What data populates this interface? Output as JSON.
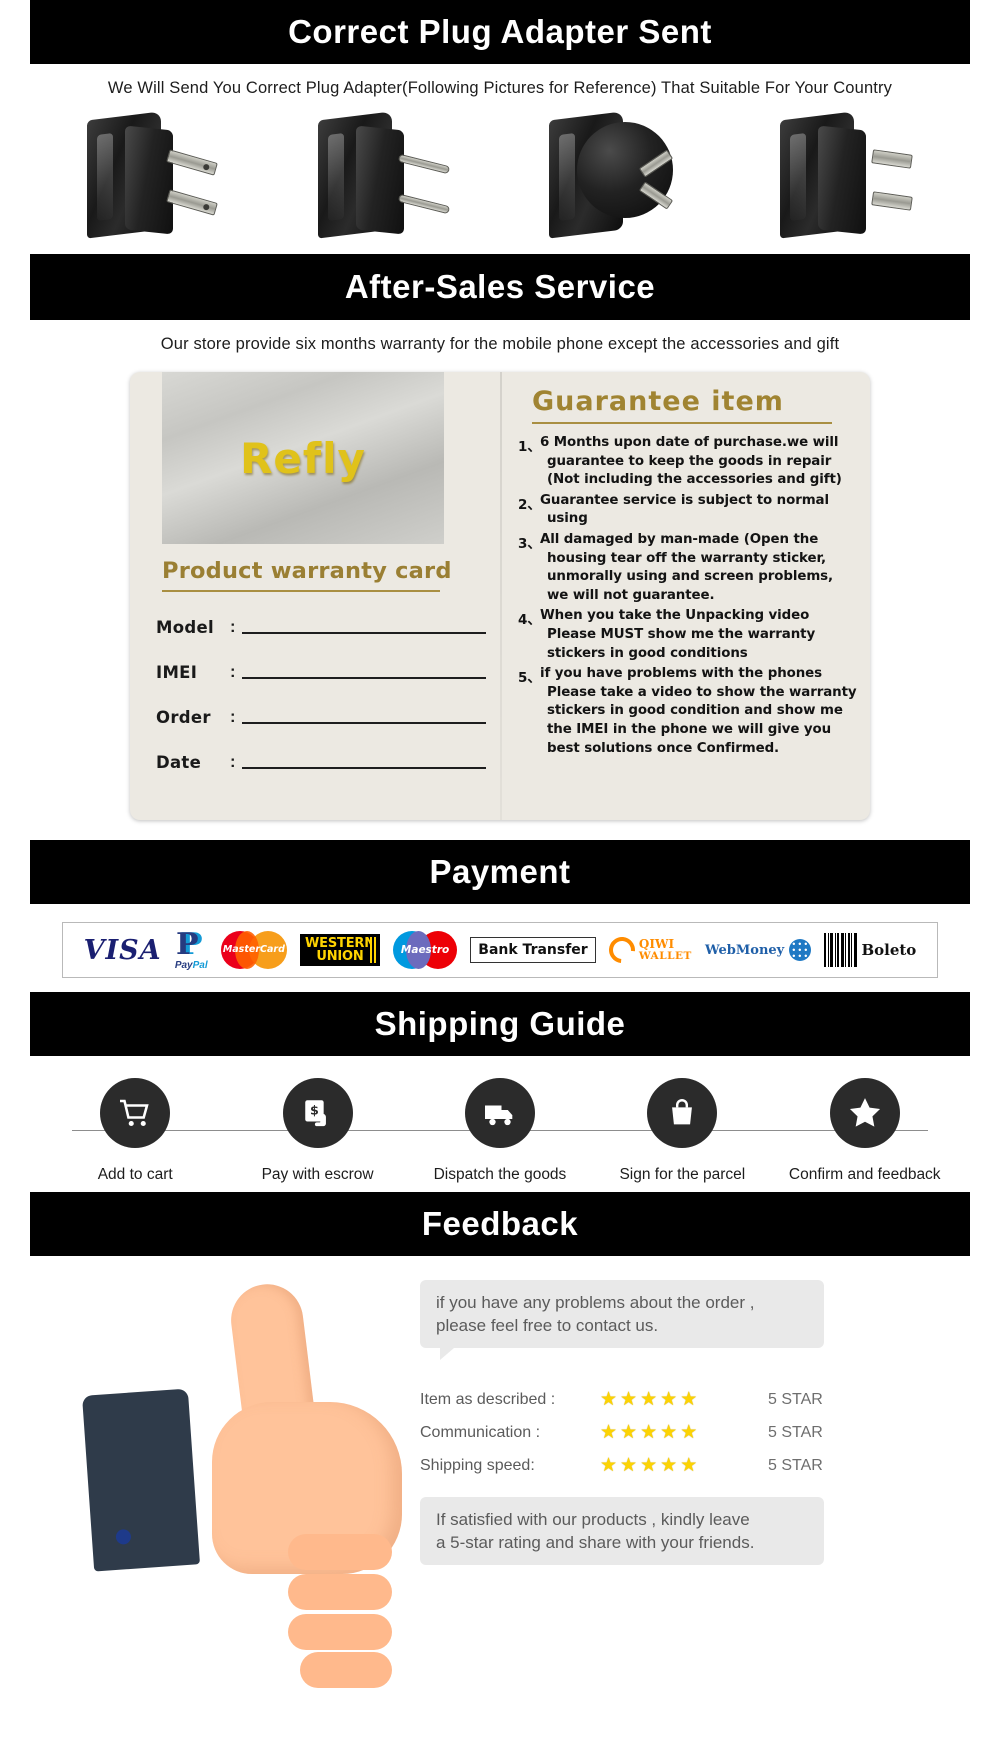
{
  "sections": {
    "plug": {
      "banner": "Correct Plug Adapter Sent",
      "subtitle": "We Will Send You Correct Plug Adapter(Following Pictures for Reference) That Suitable For Your Country",
      "adapters": [
        {
          "name": "us-plug-adapter",
          "type": "US"
        },
        {
          "name": "eu-plug-adapter",
          "type": "EU"
        },
        {
          "name": "au-plug-adapter",
          "type": "AU"
        },
        {
          "name": "uk-plug-adapter",
          "type": "UK"
        }
      ]
    },
    "after_sales": {
      "banner": "After-Sales Service",
      "note": "Our store provide  six months warranty  for the mobile  phone  except the  accessories and gift",
      "card": {
        "brand": "Refly",
        "title": "Product warranty card",
        "fields": [
          {
            "label": "Model",
            "colon": ":",
            "value": ""
          },
          {
            "label": "IMEI",
            "colon": ":",
            "value": ""
          },
          {
            "label": "Order",
            "colon": ":",
            "value": ""
          },
          {
            "label": "Date",
            "colon": ":",
            "value": ""
          }
        ],
        "guarantee_title": "Guarantee  item",
        "guarantee_items": [
          {
            "num": "1、",
            "lines": [
              "6 Months upon date of purchase.we will",
              "guarantee to keep the goods in repair",
              "(Not including the accessories and gift)"
            ]
          },
          {
            "num": "2、",
            "lines": [
              "Guarantee service is subject to normal",
              "using"
            ]
          },
          {
            "num": "3、",
            "lines": [
              "All damaged by man-made (Open the",
              "housing tear off the warranty sticker,",
              "unmorally using and screen problems,",
              "we will not guarantee."
            ]
          },
          {
            "num": "4、",
            "lines": [
              "When you take the Unpacking video",
              "Please MUST show me the warranty",
              "stickers in good conditions"
            ]
          },
          {
            "num": "5、",
            "lines": [
              "if you have problems with the phones",
              "Please take a video to show the warranty",
              "stickers in good condition and show me",
              "the IMEI in the phone we will give you",
              "best solutions once  Confirmed."
            ]
          }
        ]
      }
    },
    "payment": {
      "banner": "Payment",
      "methods": [
        {
          "name": "visa-logo",
          "label": "VISA"
        },
        {
          "name": "paypal-logo",
          "label": "PayPal"
        },
        {
          "name": "mastercard-logo",
          "label": "MasterCard"
        },
        {
          "name": "western-union-logo",
          "label": "WESTERN UNION",
          "line1": "WESTERN",
          "line2": "UNION"
        },
        {
          "name": "maestro-logo",
          "label": "Maestro"
        },
        {
          "name": "bank-transfer-logo",
          "label": "Bank Transfer"
        },
        {
          "name": "qiwi-wallet-logo",
          "label": "QIWI WALLET",
          "line1": "QIWI",
          "line2": "WALLET"
        },
        {
          "name": "webmoney-logo",
          "label": "WebMoney"
        },
        {
          "name": "boleto-logo",
          "label": "Boleto"
        }
      ]
    },
    "shipping": {
      "banner": "Shipping Guide",
      "steps": [
        {
          "icon": "shopping-cart-icon",
          "label": "Add to cart"
        },
        {
          "icon": "escrow-payment-icon",
          "label": "Pay with escrow"
        },
        {
          "icon": "delivery-truck-icon",
          "label": "Dispatch the goods"
        },
        {
          "icon": "shopping-bag-icon",
          "label": "Sign for the parcel"
        },
        {
          "icon": "star-icon",
          "label": "Confirm and feedback"
        }
      ]
    },
    "feedback": {
      "banner": "Feedback",
      "bubble_top_line1": "if you have any problems about the order ,",
      "bubble_top_line2": "please feel free to contact us.",
      "ratings": [
        {
          "label": "Item as described :",
          "stars": 5,
          "value": "5 STAR"
        },
        {
          "label": "Communication :",
          "stars": 5,
          "value": "5 STAR"
        },
        {
          "label": "Shipping speed:",
          "stars": 5,
          "value": "5 STAR"
        }
      ],
      "bubble_bottom_line1": "If satisfied with our products ,  kindly leave",
      "bubble_bottom_line2": "a 5-star rating and share with your friends."
    }
  },
  "colors": {
    "banner_bg": "#000000",
    "banner_text": "#ffffff",
    "card_gold": "#a08432",
    "brand_yellow": "#e0c21a",
    "star": "#fcd303"
  }
}
